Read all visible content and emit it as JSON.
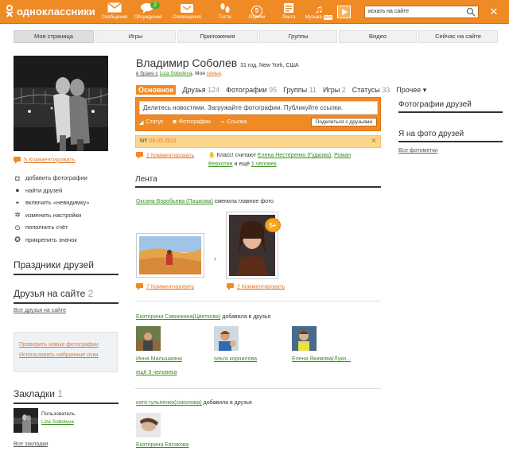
{
  "topbar": {
    "logo": "одноклассники",
    "nav": [
      {
        "label": "Сообщения",
        "icon": "envelope-icon"
      },
      {
        "label": "Обсуждения",
        "icon": "chat-icon",
        "badge": "2"
      },
      {
        "label": "Оповещения",
        "icon": "bell-icon"
      },
      {
        "label": "Гости",
        "icon": "footprints-icon"
      },
      {
        "label": "Оценки",
        "icon": "rating-icon",
        "value": "5"
      },
      {
        "label": "Лента",
        "icon": "feed-icon"
      },
      {
        "label": "Музыка",
        "icon": "music-icon",
        "beta": "beta"
      }
    ],
    "search_placeholder": "искать на сайте"
  },
  "tabs": [
    "Моя страница",
    "Игры",
    "Приложения",
    "Группы",
    "Видео",
    "Сейчас на сайте"
  ],
  "left": {
    "avatar_comments": "5 Комментировать",
    "actions": [
      {
        "label": "добавить фотографии",
        "icon": "camera-icon"
      },
      {
        "label": "найти друзей",
        "icon": "person-icon"
      },
      {
        "label": "включить «невидимку»",
        "icon": "invisible-icon"
      },
      {
        "label": "изменить настройки",
        "icon": "gear-icon"
      },
      {
        "label": "пополнить счёт",
        "icon": "coin-icon"
      },
      {
        "label": "прикрепить значок",
        "icon": "badge-icon"
      }
    ],
    "holidays_title": "Праздники друзей",
    "friends_title": "Друзья на сайте",
    "friends_count": "2",
    "friends_all": "Все друзья на сайте",
    "check_photos": "Проверить новые фотографии",
    "use_points": "Использовать набранные очки",
    "bookmarks_title": "Закладки",
    "bookmarks_count": "1",
    "bookmark_role": "Пользователь",
    "bookmark_name": "Liza Soboleva",
    "all_bookmarks": "Все закладки"
  },
  "profile": {
    "name": "Владимир Соболев",
    "meta": "31 год, New York, США",
    "married_prefix": "в браке с",
    "spouse": "Liza Soboleva",
    "family_prefix": "Моя",
    "family_link": "семья",
    "tabs": [
      {
        "label": "Основное",
        "count": ""
      },
      {
        "label": "Друзья",
        "count": "124"
      },
      {
        "label": "Фотографии",
        "count": "95"
      },
      {
        "label": "Группы",
        "count": "11"
      },
      {
        "label": "Игры",
        "count": "2"
      },
      {
        "label": "Статусы",
        "count": "33"
      },
      {
        "label": "Прочее ▾",
        "count": ""
      }
    ],
    "post_placeholder": "Делитесь новостями. Загружайте фотографии. Публикуйте ссылки.",
    "post_actions": [
      "Статус",
      "Фотографии",
      "Ссылка"
    ],
    "share_button": "Поделиться с друзьями",
    "ny_label": "NY",
    "ny_date": "09.05.2011",
    "ny_comments": "2 Комментировать",
    "class_text": "Класс! считают",
    "class_users": [
      "Елена Нестеренко (Гудкова)",
      "Роман Верхотин"
    ],
    "class_more_prefix": "и ещё",
    "class_more": "1 человек"
  },
  "feed": {
    "title": "Лента",
    "item1_user": "Оксана Воробьева (Пашкова)",
    "item1_action": "сменила главное фото",
    "photo1_comments": "7 Комментировать",
    "photo2_comments": "2 Комментировать",
    "badge": "5+",
    "item2_user": "Екатерина Савинкина(Цветкова)",
    "item2_action": "добавила в друзья",
    "item2_friends": [
      "Инна Малышкина",
      "ольга корнилова",
      "Елена Якимова(Луки..."
    ],
    "item2_more": "ещё 3 человека",
    "item3_user": "катя гульпенко(соколова)",
    "item3_action": "добавила в друзья",
    "item3_friend": "Екатерина Евсякова"
  },
  "right": {
    "friend_photos": "Фотографии друзей",
    "me_in_photos": "Я на фото друзей",
    "all_photos": "Все фотометки"
  },
  "colors": {
    "brand": "#f08a24",
    "link_orange": "#e8782a",
    "link_green": "#3a8f1e"
  }
}
